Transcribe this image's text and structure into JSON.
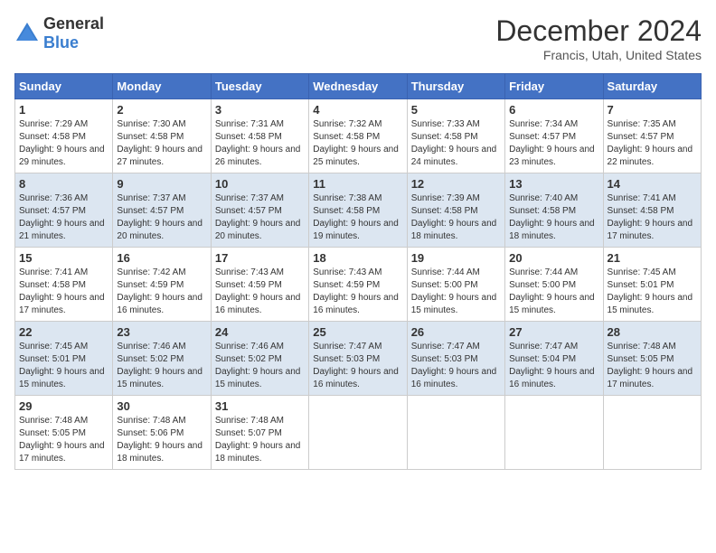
{
  "logo": {
    "general": "General",
    "blue": "Blue"
  },
  "title": "December 2024",
  "subtitle": "Francis, Utah, United States",
  "days_header": [
    "Sunday",
    "Monday",
    "Tuesday",
    "Wednesday",
    "Thursday",
    "Friday",
    "Saturday"
  ],
  "weeks": [
    [
      {
        "num": "1",
        "sunrise": "Sunrise: 7:29 AM",
        "sunset": "Sunset: 4:58 PM",
        "daylight": "Daylight: 9 hours and 29 minutes."
      },
      {
        "num": "2",
        "sunrise": "Sunrise: 7:30 AM",
        "sunset": "Sunset: 4:58 PM",
        "daylight": "Daylight: 9 hours and 27 minutes."
      },
      {
        "num": "3",
        "sunrise": "Sunrise: 7:31 AM",
        "sunset": "Sunset: 4:58 PM",
        "daylight": "Daylight: 9 hours and 26 minutes."
      },
      {
        "num": "4",
        "sunrise": "Sunrise: 7:32 AM",
        "sunset": "Sunset: 4:58 PM",
        "daylight": "Daylight: 9 hours and 25 minutes."
      },
      {
        "num": "5",
        "sunrise": "Sunrise: 7:33 AM",
        "sunset": "Sunset: 4:58 PM",
        "daylight": "Daylight: 9 hours and 24 minutes."
      },
      {
        "num": "6",
        "sunrise": "Sunrise: 7:34 AM",
        "sunset": "Sunset: 4:57 PM",
        "daylight": "Daylight: 9 hours and 23 minutes."
      },
      {
        "num": "7",
        "sunrise": "Sunrise: 7:35 AM",
        "sunset": "Sunset: 4:57 PM",
        "daylight": "Daylight: 9 hours and 22 minutes."
      }
    ],
    [
      {
        "num": "8",
        "sunrise": "Sunrise: 7:36 AM",
        "sunset": "Sunset: 4:57 PM",
        "daylight": "Daylight: 9 hours and 21 minutes."
      },
      {
        "num": "9",
        "sunrise": "Sunrise: 7:37 AM",
        "sunset": "Sunset: 4:57 PM",
        "daylight": "Daylight: 9 hours and 20 minutes."
      },
      {
        "num": "10",
        "sunrise": "Sunrise: 7:37 AM",
        "sunset": "Sunset: 4:57 PM",
        "daylight": "Daylight: 9 hours and 20 minutes."
      },
      {
        "num": "11",
        "sunrise": "Sunrise: 7:38 AM",
        "sunset": "Sunset: 4:58 PM",
        "daylight": "Daylight: 9 hours and 19 minutes."
      },
      {
        "num": "12",
        "sunrise": "Sunrise: 7:39 AM",
        "sunset": "Sunset: 4:58 PM",
        "daylight": "Daylight: 9 hours and 18 minutes."
      },
      {
        "num": "13",
        "sunrise": "Sunrise: 7:40 AM",
        "sunset": "Sunset: 4:58 PM",
        "daylight": "Daylight: 9 hours and 18 minutes."
      },
      {
        "num": "14",
        "sunrise": "Sunrise: 7:41 AM",
        "sunset": "Sunset: 4:58 PM",
        "daylight": "Daylight: 9 hours and 17 minutes."
      }
    ],
    [
      {
        "num": "15",
        "sunrise": "Sunrise: 7:41 AM",
        "sunset": "Sunset: 4:58 PM",
        "daylight": "Daylight: 9 hours and 17 minutes."
      },
      {
        "num": "16",
        "sunrise": "Sunrise: 7:42 AM",
        "sunset": "Sunset: 4:59 PM",
        "daylight": "Daylight: 9 hours and 16 minutes."
      },
      {
        "num": "17",
        "sunrise": "Sunrise: 7:43 AM",
        "sunset": "Sunset: 4:59 PM",
        "daylight": "Daylight: 9 hours and 16 minutes."
      },
      {
        "num": "18",
        "sunrise": "Sunrise: 7:43 AM",
        "sunset": "Sunset: 4:59 PM",
        "daylight": "Daylight: 9 hours and 16 minutes."
      },
      {
        "num": "19",
        "sunrise": "Sunrise: 7:44 AM",
        "sunset": "Sunset: 5:00 PM",
        "daylight": "Daylight: 9 hours and 15 minutes."
      },
      {
        "num": "20",
        "sunrise": "Sunrise: 7:44 AM",
        "sunset": "Sunset: 5:00 PM",
        "daylight": "Daylight: 9 hours and 15 minutes."
      },
      {
        "num": "21",
        "sunrise": "Sunrise: 7:45 AM",
        "sunset": "Sunset: 5:01 PM",
        "daylight": "Daylight: 9 hours and 15 minutes."
      }
    ],
    [
      {
        "num": "22",
        "sunrise": "Sunrise: 7:45 AM",
        "sunset": "Sunset: 5:01 PM",
        "daylight": "Daylight: 9 hours and 15 minutes."
      },
      {
        "num": "23",
        "sunrise": "Sunrise: 7:46 AM",
        "sunset": "Sunset: 5:02 PM",
        "daylight": "Daylight: 9 hours and 15 minutes."
      },
      {
        "num": "24",
        "sunrise": "Sunrise: 7:46 AM",
        "sunset": "Sunset: 5:02 PM",
        "daylight": "Daylight: 9 hours and 15 minutes."
      },
      {
        "num": "25",
        "sunrise": "Sunrise: 7:47 AM",
        "sunset": "Sunset: 5:03 PM",
        "daylight": "Daylight: 9 hours and 16 minutes."
      },
      {
        "num": "26",
        "sunrise": "Sunrise: 7:47 AM",
        "sunset": "Sunset: 5:03 PM",
        "daylight": "Daylight: 9 hours and 16 minutes."
      },
      {
        "num": "27",
        "sunrise": "Sunrise: 7:47 AM",
        "sunset": "Sunset: 5:04 PM",
        "daylight": "Daylight: 9 hours and 16 minutes."
      },
      {
        "num": "28",
        "sunrise": "Sunrise: 7:48 AM",
        "sunset": "Sunset: 5:05 PM",
        "daylight": "Daylight: 9 hours and 17 minutes."
      }
    ],
    [
      {
        "num": "29",
        "sunrise": "Sunrise: 7:48 AM",
        "sunset": "Sunset: 5:05 PM",
        "daylight": "Daylight: 9 hours and 17 minutes."
      },
      {
        "num": "30",
        "sunrise": "Sunrise: 7:48 AM",
        "sunset": "Sunset: 5:06 PM",
        "daylight": "Daylight: 9 hours and 18 minutes."
      },
      {
        "num": "31",
        "sunrise": "Sunrise: 7:48 AM",
        "sunset": "Sunset: 5:07 PM",
        "daylight": "Daylight: 9 hours and 18 minutes."
      },
      null,
      null,
      null,
      null
    ]
  ]
}
